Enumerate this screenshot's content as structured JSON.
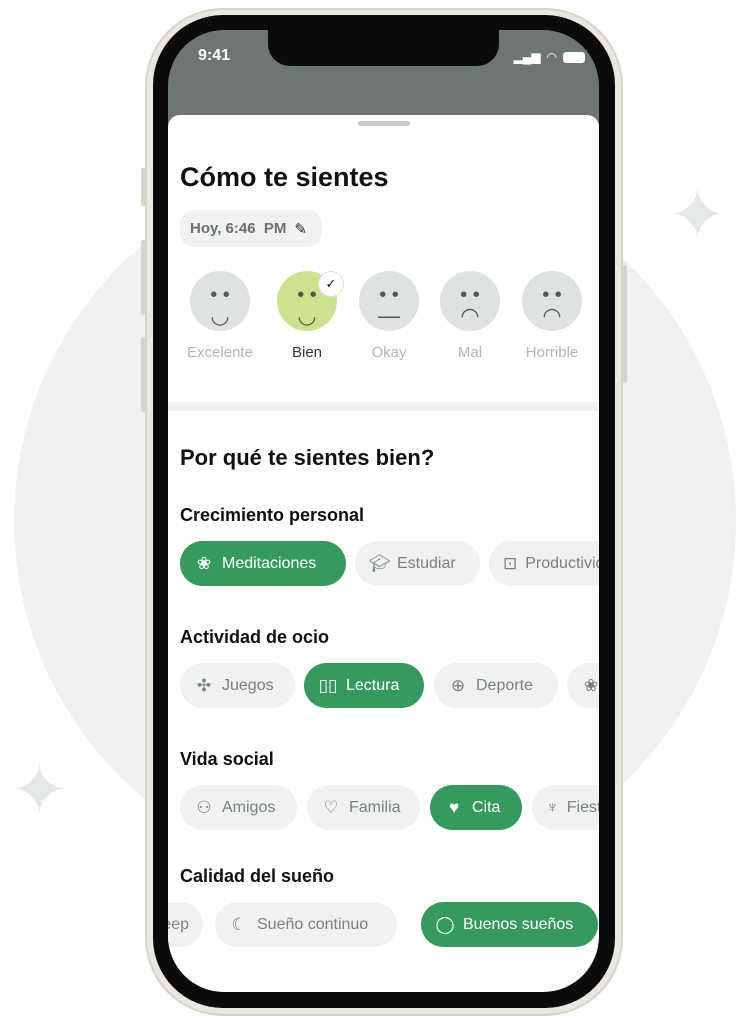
{
  "status": {
    "time": "9:41"
  },
  "title": "Cómo te sientes",
  "date": {
    "label": "Hoy, 6:46  PM",
    "icon": "pencil-icon"
  },
  "moods": [
    {
      "label": "Excelente",
      "icon": "smile-icon",
      "selected": false
    },
    {
      "label": "Bien",
      "icon": "smile-icon",
      "selected": true
    },
    {
      "label": "Okay",
      "icon": "neutral-face-icon",
      "selected": false
    },
    {
      "label": "Mal",
      "icon": "frown-icon",
      "selected": false
    },
    {
      "label": "Horrible",
      "icon": "frown-icon",
      "selected": false
    }
  ],
  "question": "Por qué te sientes bien?",
  "sections": [
    {
      "title": "Crecimiento personal",
      "chips": [
        {
          "label": "Meditaciones",
          "icon": "lotus-icon",
          "selected": true
        },
        {
          "label": "Estudiar",
          "icon": "graduation-cap-icon",
          "selected": false
        },
        {
          "label": "Productividad",
          "icon": "briefcase-icon",
          "selected": false
        }
      ]
    },
    {
      "title": "Actividad de ocio",
      "chips": [
        {
          "label": "Juegos",
          "icon": "puzzle-icon",
          "selected": false
        },
        {
          "label": "Lectura",
          "icon": "book-icon",
          "selected": true
        },
        {
          "label": "Deporte",
          "icon": "basketball-icon",
          "selected": false
        },
        {
          "label": "",
          "icon": "lotus-icon",
          "selected": false
        }
      ]
    },
    {
      "title": "Vida social",
      "chips": [
        {
          "label": "Amigos",
          "icon": "people-icon",
          "selected": false
        },
        {
          "label": "Familia",
          "icon": "heart-icon",
          "selected": false
        },
        {
          "label": "Cita",
          "icon": "sparkle-heart-icon",
          "selected": true
        },
        {
          "label": "Fiesta",
          "icon": "wine-glass-icon",
          "selected": false
        }
      ]
    },
    {
      "title": "Calidad del sueño",
      "chips": [
        {
          "label": "Deep sleep",
          "icon": "",
          "selected": false
        },
        {
          "label": "Sueño continuo",
          "icon": "moon-icon",
          "selected": false
        },
        {
          "label": "Buenos sueños",
          "icon": "balloon-icon",
          "selected": true
        }
      ]
    }
  ],
  "colors": {
    "accent": "#369a5e",
    "selected_mood": "#cde28f",
    "chip_bg": "#f0f2f1"
  }
}
